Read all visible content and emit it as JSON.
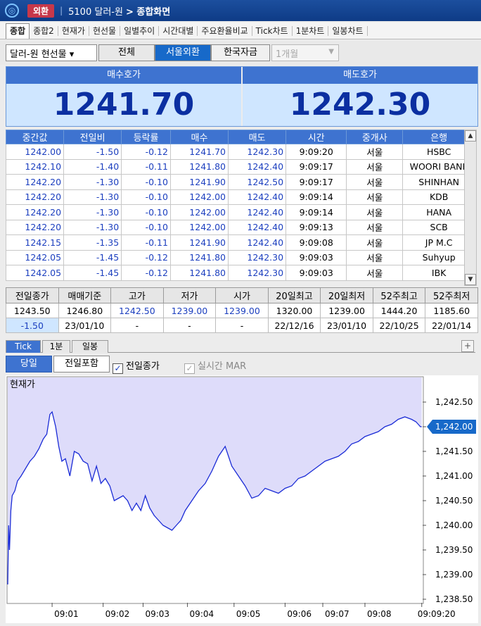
{
  "titlebar": {
    "app_icon": "stock-app-icon",
    "badge": "외환",
    "code": "5100 달러-원",
    "screen": "> 종합화면"
  },
  "tabs": [
    "종합",
    "종합2",
    "현재가",
    "현선물",
    "일별추이",
    "시간대별",
    "주요환율비교",
    "Tick차트",
    "1분차트",
    "일봉차트"
  ],
  "filters": {
    "instrument": "달러-원 현선물",
    "seg_all": "전체",
    "seg_seoul": "서울외환",
    "seg_korea": "한국자금",
    "period": "1개월"
  },
  "quote": {
    "bid_label": "매수호가",
    "ask_label": "매도호가",
    "bid": "1241.70",
    "ask": "1242.30"
  },
  "ticks": {
    "headers": [
      "중간값",
      "전일비",
      "등락률",
      "매수",
      "매도",
      "시간",
      "중개사",
      "은행"
    ],
    "rows": [
      [
        "1242.00",
        "-1.50",
        "-0.12",
        "1241.70",
        "1242.30",
        "9:09:20",
        "서울",
        "HSBC"
      ],
      [
        "1242.10",
        "-1.40",
        "-0.11",
        "1241.80",
        "1242.40",
        "9:09:17",
        "서울",
        "WOORI BANK"
      ],
      [
        "1242.20",
        "-1.30",
        "-0.10",
        "1241.90",
        "1242.50",
        "9:09:17",
        "서울",
        "SHINHAN"
      ],
      [
        "1242.20",
        "-1.30",
        "-0.10",
        "1242.00",
        "1242.40",
        "9:09:14",
        "서울",
        "KDB"
      ],
      [
        "1242.20",
        "-1.30",
        "-0.10",
        "1242.00",
        "1242.40",
        "9:09:14",
        "서울",
        "HANA"
      ],
      [
        "1242.20",
        "-1.30",
        "-0.10",
        "1242.00",
        "1242.40",
        "9:09:13",
        "서울",
        "SCB"
      ],
      [
        "1242.15",
        "-1.35",
        "-0.11",
        "1241.90",
        "1242.40",
        "9:09:08",
        "서울",
        "JP M.C"
      ],
      [
        "1242.05",
        "-1.45",
        "-0.12",
        "1241.80",
        "1242.30",
        "9:09:03",
        "서울",
        "Suhyup"
      ],
      [
        "1242.05",
        "-1.45",
        "-0.12",
        "1241.80",
        "1242.30",
        "9:09:03",
        "서울",
        "IBK"
      ]
    ]
  },
  "summary": {
    "headers": [
      "전일종가",
      "매매기준",
      "고가",
      "저가",
      "시가",
      "20일최고",
      "20일최저",
      "52주최고",
      "52주최저"
    ],
    "row1": [
      "1243.50",
      "1246.80",
      "1242.50",
      "1239.00",
      "1239.00",
      "1320.00",
      "1239.00",
      "1444.20",
      "1185.60"
    ],
    "row2": [
      "-1.50",
      "23/01/10",
      "-",
      "-",
      "-",
      "22/12/16",
      "23/01/10",
      "22/10/25",
      "22/01/14"
    ]
  },
  "chart_tabs": [
    "Tick",
    "1분",
    "일봉"
  ],
  "chart_opts": {
    "today": "당일",
    "incl_prev": "전일포함",
    "prev_close": "전일종가",
    "realtime_mar": "실시간 MAR"
  },
  "chart_data": {
    "type": "line",
    "title": "현재가",
    "x_tick_labels": [
      "09:01",
      "09:02",
      "09:03",
      "09:04",
      "09:05",
      "09:06",
      "09:07",
      "09:08",
      "09:09:20"
    ],
    "y_tick_labels": [
      "1,242.50",
      "1,242.00",
      "1,241.50",
      "1,241.00",
      "1,240.50",
      "1,240.00",
      "1,239.50",
      "1,239.00",
      "1,238.50"
    ],
    "ylim": [
      1238.5,
      1242.5
    ],
    "current_value": "1,242.00",
    "x_minutes": [
      0.0,
      0.02,
      0.04,
      0.07,
      0.1,
      0.16,
      0.22,
      0.3,
      0.4,
      0.5,
      0.6,
      0.7,
      0.8,
      0.88,
      0.95,
      1.0,
      1.08,
      1.15,
      1.22,
      1.3,
      1.4,
      1.5,
      1.6,
      1.7,
      1.8,
      1.9,
      2.0,
      2.1,
      2.2,
      2.3,
      2.4,
      2.5,
      2.6,
      2.7,
      2.8,
      2.9,
      3.0,
      3.1,
      3.2,
      3.3,
      3.4,
      3.5,
      3.6,
      3.7,
      3.8,
      3.9,
      4.0,
      4.15,
      4.3,
      4.45,
      4.6,
      4.75,
      4.9,
      5.05,
      5.2,
      5.35,
      5.5,
      5.65,
      5.8,
      5.95,
      6.1,
      6.25,
      6.4,
      6.55,
      6.7,
      6.85,
      7.0,
      7.15,
      7.3,
      7.45,
      7.6,
      7.75,
      7.9,
      8.05,
      8.2,
      8.35,
      8.5,
      8.65,
      8.8,
      8.95,
      9.1,
      9.2,
      9.25,
      9.3,
      9.33
    ],
    "y_values": [
      1238.8,
      1240.0,
      1239.5,
      1240.3,
      1240.6,
      1240.7,
      1240.9,
      1241.0,
      1241.15,
      1241.3,
      1241.4,
      1241.55,
      1241.75,
      1241.85,
      1242.25,
      1242.3,
      1242.0,
      1241.6,
      1241.3,
      1241.35,
      1241.0,
      1241.5,
      1241.45,
      1241.3,
      1241.25,
      1240.9,
      1241.2,
      1240.85,
      1240.95,
      1240.8,
      1240.5,
      1240.55,
      1240.6,
      1240.5,
      1240.3,
      1240.45,
      1240.3,
      1240.6,
      1240.35,
      1240.2,
      1240.1,
      1240.0,
      1239.95,
      1239.9,
      1240.0,
      1240.1,
      1240.3,
      1240.5,
      1240.7,
      1240.85,
      1241.1,
      1241.4,
      1241.6,
      1241.2,
      1241.0,
      1240.8,
      1240.55,
      1240.6,
      1240.75,
      1240.7,
      1240.65,
      1240.75,
      1240.8,
      1240.95,
      1241.0,
      1241.1,
      1241.2,
      1241.3,
      1241.35,
      1241.4,
      1241.5,
      1241.65,
      1241.7,
      1241.8,
      1241.85,
      1241.9,
      1242.0,
      1242.05,
      1242.15,
      1242.2,
      1242.15,
      1242.1,
      1242.05,
      1242.0,
      1242.0
    ],
    "colors": {
      "line": "#1a2bd6",
      "fill": "#dedcfa",
      "marker": "#1769c9"
    }
  }
}
